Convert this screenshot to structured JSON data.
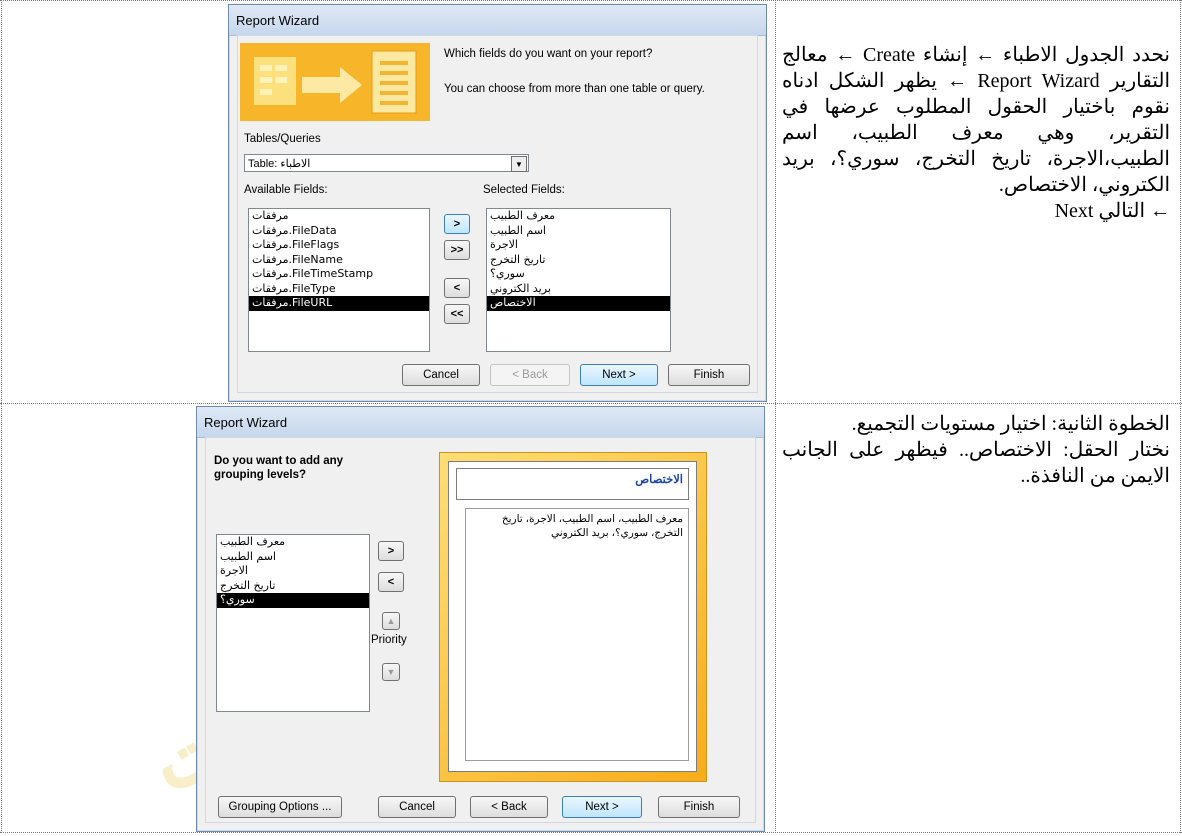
{
  "dialog1": {
    "title": "Report Wizard",
    "question": "Which fields do you want on your report?",
    "hint": "You can choose from more than one table or query.",
    "tables_label": "Tables/Queries",
    "tables_value": "Table: الاطباء",
    "available_label": "Available Fields:",
    "selected_label": "Selected Fields:",
    "available_fields": [
      "مرفقات",
      "مرفقات.FileData",
      "مرفقات.FileFlags",
      "مرفقات.FileName",
      "مرفقات.FileTimeStamp",
      "مرفقات.FileType",
      "مرفقات.FileURL"
    ],
    "selected_fields": [
      "معرف الطبيب",
      "اسم الطبيب",
      "الاجرة",
      "تاريخ التخرج",
      "سوري؟",
      "بريد الكتروني",
      "الاختصاص"
    ],
    "btn_add": ">",
    "btn_add_all": ">>",
    "btn_remove": "<",
    "btn_remove_all": "<<",
    "btn_cancel": "Cancel",
    "btn_back": "< Back",
    "btn_next": "Next >",
    "btn_finish": "Finish"
  },
  "dialog2": {
    "title": "Report Wizard",
    "question": "Do you want to add any grouping levels?",
    "fields": [
      "معرف الطبيب",
      "اسم الطبيب",
      "الاجرة",
      "تاريخ التخرج",
      "سوري؟"
    ],
    "btn_add": ">",
    "btn_remove": "<",
    "priority_label": "Priority",
    "preview_group": "الاختصاص",
    "preview_detail": "معرف الطبيب، اسم الطبيب، الاجرة، تاريخ التخرج، سوري؟، بريد الكتروني",
    "btn_grouping": "Grouping Options ...",
    "btn_cancel": "Cancel",
    "btn_back": "< Back",
    "btn_next": "Next >",
    "btn_finish": "Finish"
  },
  "instructions": {
    "step1": "نحدد الجدول الاطباء ← إنشاء Create ← معالج التقارير Report Wizard ← يظهر الشكل ادناه نقوم باختيار الحقول المطلوب عرضها في التقرير، وهي معرف الطبيب، اسم الطبيب،الاجرة، تاريخ التخرج، سوري؟، بريد الكتروني، الاختصاص.",
    "step1_next": "← التالي Next",
    "step2_title": "الخطوة الثانية: اختيار مستويات التجميع.",
    "step2_body": "نختار الحقل: الاختصاص.. فيظهر على الجانب الايمن من النافذة.."
  },
  "watermark_glyphs": [
    "م",
    "ع",
    "ه",
    "ت"
  ],
  "colors": {
    "selection": "#000000",
    "wizard_accent": "#f8ad1a",
    "title_bar": "#c6d7ec"
  }
}
